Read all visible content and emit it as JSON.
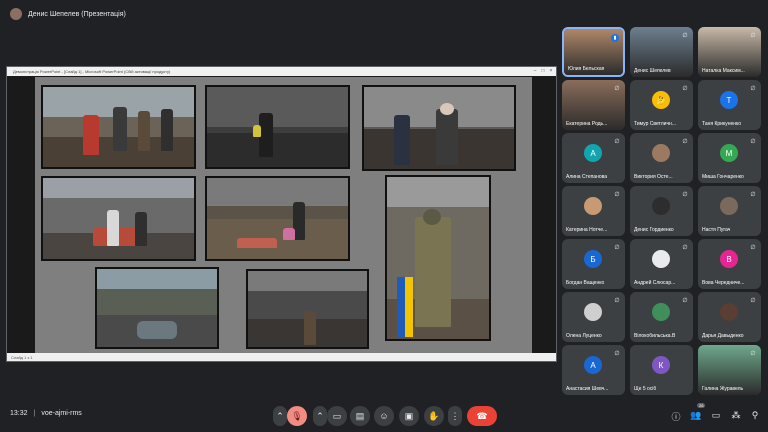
{
  "header": {
    "presenter_title": "Денис Шепелев (Презентація)"
  },
  "ppt": {
    "title": "Демонстрація PowerPoint - [Слайд 1] - Microsoft PowerPoint (Сбій активації продукту)",
    "status": "Слайд 1 з 1"
  },
  "tiles": [
    {
      "name": "Юлия Бельская",
      "kind": "photo",
      "color": "#b0876a",
      "speaking": true
    },
    {
      "name": "Денис Шепелев",
      "kind": "photo",
      "color": "#6d7f8f",
      "muted": true
    },
    {
      "name": "Наталка Максим...",
      "kind": "photo",
      "color": "#c9b9a8",
      "muted": true
    },
    {
      "name": "Екатерина Родь...",
      "kind": "photo",
      "color": "#8a6d5a",
      "muted": true
    },
    {
      "name": "Тимур Светличн...",
      "kind": "emoji",
      "glyph": "🤔",
      "color": "#3c4043",
      "muted": true
    },
    {
      "name": "Таня Крикуненко",
      "kind": "letter",
      "letter": "Т",
      "color": "#1a73e8",
      "muted": true
    },
    {
      "name": "Алина Степанова",
      "kind": "letter",
      "letter": "А",
      "color": "#12a4af",
      "muted": true
    },
    {
      "name": "Виктория Осте...",
      "kind": "photo-round",
      "color": "#9c7a61",
      "muted": true
    },
    {
      "name": "Миша Гончаренко",
      "kind": "letter",
      "letter": "М",
      "color": "#34a853",
      "muted": true
    },
    {
      "name": "Катерина Нотче...",
      "kind": "photo-round",
      "color": "#c89a73",
      "muted": true
    },
    {
      "name": "Денис Гордиенко",
      "kind": "photo-round",
      "color": "#2d2d2d",
      "muted": true
    },
    {
      "name": "Настя Пугач",
      "kind": "photo-round",
      "color": "#7b6a5c",
      "muted": true
    },
    {
      "name": "Богдан Ващенко",
      "kind": "letter",
      "letter": "Б",
      "color": "#1967d2",
      "muted": true
    },
    {
      "name": "Андрей Слюсар...",
      "kind": "photo-round",
      "color": "#e8eaed",
      "muted": true
    },
    {
      "name": "Вова Чередниче...",
      "kind": "letter",
      "letter": "В",
      "color": "#e52592",
      "muted": true
    },
    {
      "name": "Олена Луценко",
      "kind": "photo-round",
      "color": "#cfcfcf",
      "muted": true
    },
    {
      "name": "Вілокобильська.В",
      "kind": "photo-round",
      "color": "#3f8f5a",
      "muted": true
    },
    {
      "name": "Дарья Давыденко",
      "kind": "photo-round",
      "color": "#5a3d33",
      "muted": true
    },
    {
      "name": "Анастасия Шевч...",
      "kind": "letter",
      "letter": "А",
      "color": "#1967d2",
      "muted": true
    },
    {
      "name": "Ще 5 осіб",
      "kind": "group",
      "letter": "К",
      "color": "#7e57c2"
    },
    {
      "name": "Галина Журавель",
      "kind": "photo",
      "color": "#6fa88c",
      "muted": true
    }
  ],
  "bottom": {
    "time": "13:32",
    "code": "voe-ajmi-rms",
    "participants_count": "26",
    "icons": [
      "chevron-up-icon",
      "mic-off-icon",
      "chevron-up-icon",
      "camera-icon",
      "captions-icon",
      "emoji-icon",
      "present-icon",
      "raise-hand-icon",
      "more-icon",
      "hangup-icon"
    ],
    "right_icons": [
      "info-icon",
      "people-icon",
      "chat-icon",
      "activities-icon",
      "lock-icon"
    ]
  },
  "colors": {
    "background": "#202124",
    "tile": "#3c4043",
    "accent": "#8ab4f8",
    "hangup": "#ea4335",
    "slide": "#7f7f7f"
  }
}
